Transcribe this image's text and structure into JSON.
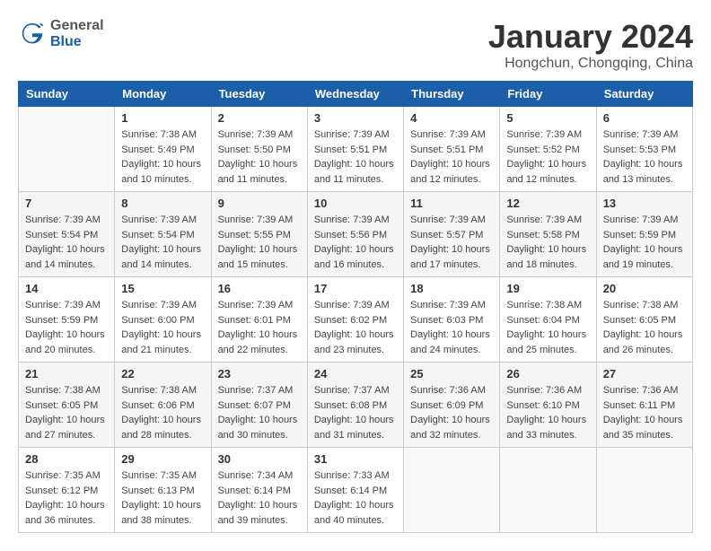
{
  "header": {
    "logo_general": "General",
    "logo_blue": "Blue",
    "month_title": "January 2024",
    "location": "Hongchun, Chongqing, China"
  },
  "weekdays": [
    "Sunday",
    "Monday",
    "Tuesday",
    "Wednesday",
    "Thursday",
    "Friday",
    "Saturday"
  ],
  "weeks": [
    [
      {
        "day": "",
        "sunrise": "",
        "sunset": "",
        "daylight": "",
        "empty": true
      },
      {
        "day": "1",
        "sunrise": "Sunrise: 7:38 AM",
        "sunset": "Sunset: 5:49 PM",
        "daylight": "Daylight: 10 hours and 10 minutes."
      },
      {
        "day": "2",
        "sunrise": "Sunrise: 7:39 AM",
        "sunset": "Sunset: 5:50 PM",
        "daylight": "Daylight: 10 hours and 11 minutes."
      },
      {
        "day": "3",
        "sunrise": "Sunrise: 7:39 AM",
        "sunset": "Sunset: 5:51 PM",
        "daylight": "Daylight: 10 hours and 11 minutes."
      },
      {
        "day": "4",
        "sunrise": "Sunrise: 7:39 AM",
        "sunset": "Sunset: 5:51 PM",
        "daylight": "Daylight: 10 hours and 12 minutes."
      },
      {
        "day": "5",
        "sunrise": "Sunrise: 7:39 AM",
        "sunset": "Sunset: 5:52 PM",
        "daylight": "Daylight: 10 hours and 12 minutes."
      },
      {
        "day": "6",
        "sunrise": "Sunrise: 7:39 AM",
        "sunset": "Sunset: 5:53 PM",
        "daylight": "Daylight: 10 hours and 13 minutes."
      }
    ],
    [
      {
        "day": "7",
        "sunrise": "Sunrise: 7:39 AM",
        "sunset": "Sunset: 5:54 PM",
        "daylight": "Daylight: 10 hours and 14 minutes."
      },
      {
        "day": "8",
        "sunrise": "Sunrise: 7:39 AM",
        "sunset": "Sunset: 5:54 PM",
        "daylight": "Daylight: 10 hours and 14 minutes."
      },
      {
        "day": "9",
        "sunrise": "Sunrise: 7:39 AM",
        "sunset": "Sunset: 5:55 PM",
        "daylight": "Daylight: 10 hours and 15 minutes."
      },
      {
        "day": "10",
        "sunrise": "Sunrise: 7:39 AM",
        "sunset": "Sunset: 5:56 PM",
        "daylight": "Daylight: 10 hours and 16 minutes."
      },
      {
        "day": "11",
        "sunrise": "Sunrise: 7:39 AM",
        "sunset": "Sunset: 5:57 PM",
        "daylight": "Daylight: 10 hours and 17 minutes."
      },
      {
        "day": "12",
        "sunrise": "Sunrise: 7:39 AM",
        "sunset": "Sunset: 5:58 PM",
        "daylight": "Daylight: 10 hours and 18 minutes."
      },
      {
        "day": "13",
        "sunrise": "Sunrise: 7:39 AM",
        "sunset": "Sunset: 5:59 PM",
        "daylight": "Daylight: 10 hours and 19 minutes."
      }
    ],
    [
      {
        "day": "14",
        "sunrise": "Sunrise: 7:39 AM",
        "sunset": "Sunset: 5:59 PM",
        "daylight": "Daylight: 10 hours and 20 minutes."
      },
      {
        "day": "15",
        "sunrise": "Sunrise: 7:39 AM",
        "sunset": "Sunset: 6:00 PM",
        "daylight": "Daylight: 10 hours and 21 minutes."
      },
      {
        "day": "16",
        "sunrise": "Sunrise: 7:39 AM",
        "sunset": "Sunset: 6:01 PM",
        "daylight": "Daylight: 10 hours and 22 minutes."
      },
      {
        "day": "17",
        "sunrise": "Sunrise: 7:39 AM",
        "sunset": "Sunset: 6:02 PM",
        "daylight": "Daylight: 10 hours and 23 minutes."
      },
      {
        "day": "18",
        "sunrise": "Sunrise: 7:39 AM",
        "sunset": "Sunset: 6:03 PM",
        "daylight": "Daylight: 10 hours and 24 minutes."
      },
      {
        "day": "19",
        "sunrise": "Sunrise: 7:38 AM",
        "sunset": "Sunset: 6:04 PM",
        "daylight": "Daylight: 10 hours and 25 minutes."
      },
      {
        "day": "20",
        "sunrise": "Sunrise: 7:38 AM",
        "sunset": "Sunset: 6:05 PM",
        "daylight": "Daylight: 10 hours and 26 minutes."
      }
    ],
    [
      {
        "day": "21",
        "sunrise": "Sunrise: 7:38 AM",
        "sunset": "Sunset: 6:05 PM",
        "daylight": "Daylight: 10 hours and 27 minutes."
      },
      {
        "day": "22",
        "sunrise": "Sunrise: 7:38 AM",
        "sunset": "Sunset: 6:06 PM",
        "daylight": "Daylight: 10 hours and 28 minutes."
      },
      {
        "day": "23",
        "sunrise": "Sunrise: 7:37 AM",
        "sunset": "Sunset: 6:07 PM",
        "daylight": "Daylight: 10 hours and 30 minutes."
      },
      {
        "day": "24",
        "sunrise": "Sunrise: 7:37 AM",
        "sunset": "Sunset: 6:08 PM",
        "daylight": "Daylight: 10 hours and 31 minutes."
      },
      {
        "day": "25",
        "sunrise": "Sunrise: 7:36 AM",
        "sunset": "Sunset: 6:09 PM",
        "daylight": "Daylight: 10 hours and 32 minutes."
      },
      {
        "day": "26",
        "sunrise": "Sunrise: 7:36 AM",
        "sunset": "Sunset: 6:10 PM",
        "daylight": "Daylight: 10 hours and 33 minutes."
      },
      {
        "day": "27",
        "sunrise": "Sunrise: 7:36 AM",
        "sunset": "Sunset: 6:11 PM",
        "daylight": "Daylight: 10 hours and 35 minutes."
      }
    ],
    [
      {
        "day": "28",
        "sunrise": "Sunrise: 7:35 AM",
        "sunset": "Sunset: 6:12 PM",
        "daylight": "Daylight: 10 hours and 36 minutes."
      },
      {
        "day": "29",
        "sunrise": "Sunrise: 7:35 AM",
        "sunset": "Sunset: 6:13 PM",
        "daylight": "Daylight: 10 hours and 38 minutes."
      },
      {
        "day": "30",
        "sunrise": "Sunrise: 7:34 AM",
        "sunset": "Sunset: 6:14 PM",
        "daylight": "Daylight: 10 hours and 39 minutes."
      },
      {
        "day": "31",
        "sunrise": "Sunrise: 7:33 AM",
        "sunset": "Sunset: 6:14 PM",
        "daylight": "Daylight: 10 hours and 40 minutes."
      },
      {
        "day": "",
        "sunrise": "",
        "sunset": "",
        "daylight": "",
        "empty": true
      },
      {
        "day": "",
        "sunrise": "",
        "sunset": "",
        "daylight": "",
        "empty": true
      },
      {
        "day": "",
        "sunrise": "",
        "sunset": "",
        "daylight": "",
        "empty": true
      }
    ]
  ]
}
